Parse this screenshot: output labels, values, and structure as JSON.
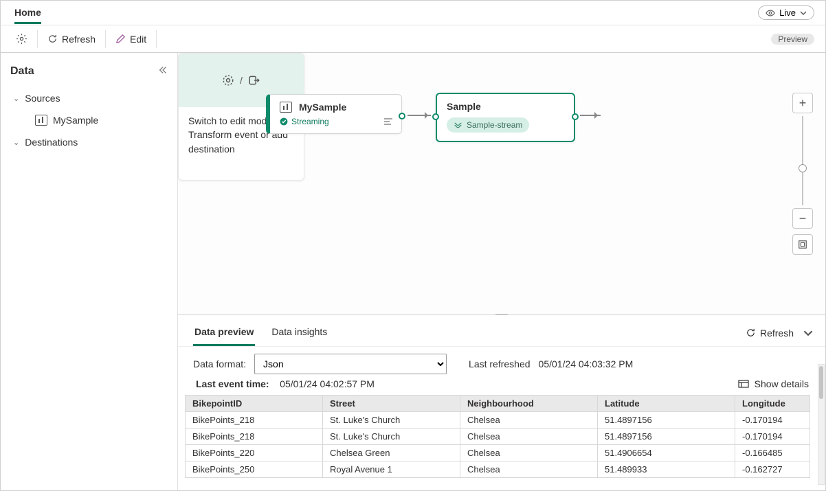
{
  "tabs": {
    "home": "Home"
  },
  "live": {
    "label": "Live"
  },
  "toolbar": {
    "refresh": "Refresh",
    "edit": "Edit",
    "preview": "Preview"
  },
  "sidebar": {
    "title": "Data",
    "sources_label": "Sources",
    "destinations_label": "Destinations",
    "source_item": "MySample"
  },
  "canvas": {
    "source": {
      "title": "MySample",
      "status": "Streaming"
    },
    "stream": {
      "title": "Sample",
      "chip": "Sample-stream"
    },
    "dest": {
      "hint": "Switch to edit mode to Transform event or add destination",
      "slash": "/"
    }
  },
  "bottom": {
    "tabs": {
      "preview": "Data preview",
      "insights": "Data insights"
    },
    "refresh": "Refresh",
    "format_label": "Data format:",
    "format_value": "Json",
    "last_refreshed_label": "Last refreshed",
    "last_refreshed_value": "05/01/24 04:03:32 PM",
    "last_event_label": "Last event time:",
    "last_event_value": "05/01/24 04:02:57 PM",
    "show_details": "Show details",
    "columns": [
      "BikepointID",
      "Street",
      "Neighbourhood",
      "Latitude",
      "Longitude"
    ],
    "rows": [
      {
        "id": "BikePoints_218",
        "street": "St. Luke's Church",
        "hood": "Chelsea",
        "lat": "51.4897156",
        "lon": "-0.170194"
      },
      {
        "id": "BikePoints_218",
        "street": "St. Luke's Church",
        "hood": "Chelsea",
        "lat": "51.4897156",
        "lon": "-0.170194"
      },
      {
        "id": "BikePoints_220",
        "street": "Chelsea Green",
        "hood": "Chelsea",
        "lat": "51.4906654",
        "lon": "-0.166485"
      },
      {
        "id": "BikePoints_250",
        "street": "Royal Avenue 1",
        "hood": "Chelsea",
        "lat": "51.489933",
        "lon": "-0.162727"
      }
    ]
  }
}
